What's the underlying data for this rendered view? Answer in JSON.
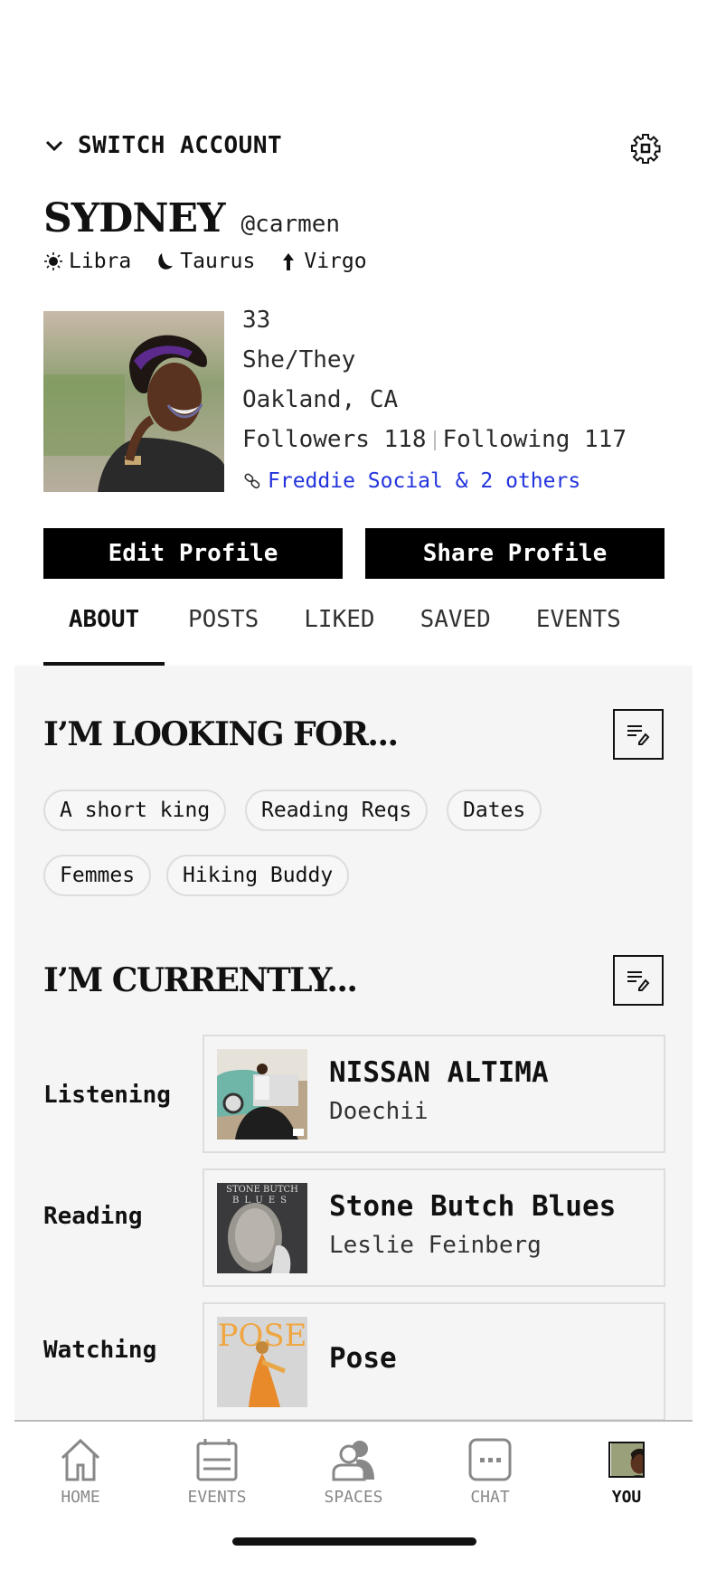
{
  "header": {
    "switch_account_label": "SWITCH ACCOUNT",
    "settings_icon": "gear-icon"
  },
  "profile": {
    "name": "SYDNEY",
    "handle": "@carmen",
    "astro": [
      {
        "icon": "sun-icon",
        "sign": "Libra"
      },
      {
        "icon": "moon-icon",
        "sign": "Taurus"
      },
      {
        "icon": "rising-arrow-icon",
        "sign": "Virgo"
      }
    ],
    "age": "33",
    "pronouns": "She/They",
    "location": "Oakland, CA",
    "followers_label": "Followers 118",
    "following_label": "Following 117",
    "links_label": "Freddie Social & 2 others",
    "link_color": "#2233dd"
  },
  "actions": {
    "edit_label": "Edit Profile",
    "share_label": "Share Profile"
  },
  "tabs": [
    {
      "label": "ABOUT",
      "active": true
    },
    {
      "label": "POSTS",
      "active": false
    },
    {
      "label": "LIKED",
      "active": false
    },
    {
      "label": "SAVED",
      "active": false
    },
    {
      "label": "EVENTS",
      "active": false
    }
  ],
  "looking_for": {
    "title": "I’M LOOKING FOR...",
    "chips": [
      "A short king",
      "Reading Reqs",
      "Dates",
      "Femmes",
      "Hiking Buddy"
    ]
  },
  "currently": {
    "title": "I’M CURRENTLY...",
    "rows": [
      {
        "label": "Listening",
        "title": "NISSAN ALTIMA",
        "subtitle": "Doechii"
      },
      {
        "label": "Reading",
        "title": "Stone Butch Blues",
        "subtitle": "Leslie Feinberg"
      },
      {
        "label": "Watching",
        "title": "Pose",
        "subtitle": ""
      }
    ]
  },
  "nav": {
    "items": [
      {
        "label": "HOME",
        "icon": "home-icon",
        "active": false
      },
      {
        "label": "EVENTS",
        "icon": "calendar-icon",
        "active": false
      },
      {
        "label": "SPACES",
        "icon": "people-icon",
        "active": false
      },
      {
        "label": "CHAT",
        "icon": "chat-icon",
        "active": false
      },
      {
        "label": "YOU",
        "icon": "avatar",
        "active": true
      }
    ]
  }
}
